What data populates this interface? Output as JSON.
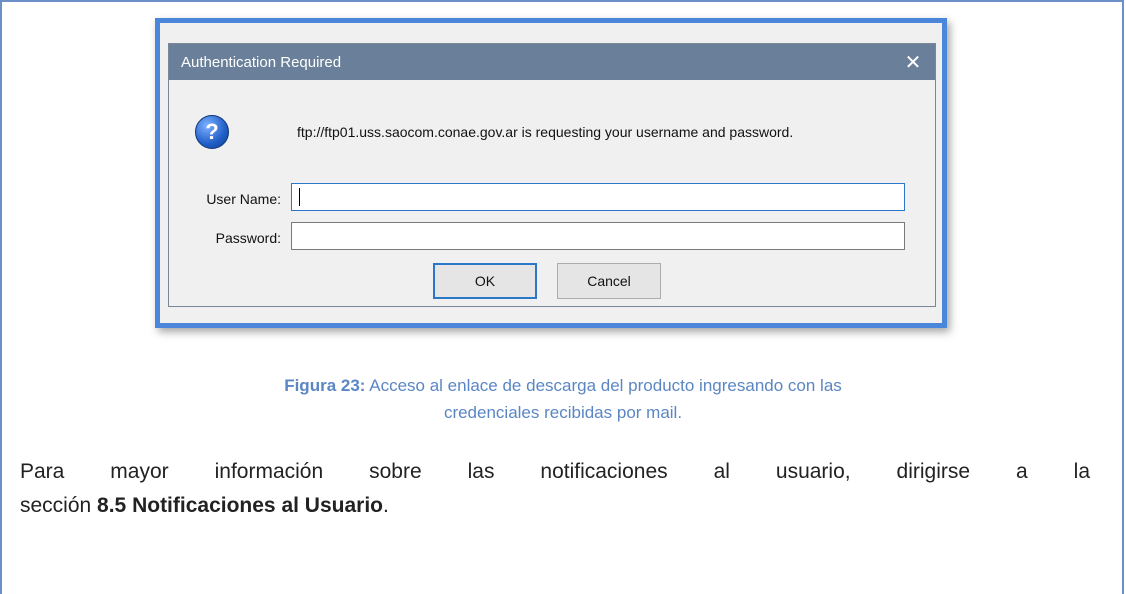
{
  "dialog": {
    "title": "Authentication Required",
    "message": "ftp://ftp01.uss.saocom.conae.gov.ar is requesting your username and password.",
    "username_label": "User Name:",
    "username_value": "",
    "password_label": "Password:",
    "password_value": "",
    "ok_label": "OK",
    "cancel_label": "Cancel",
    "question_icon_glyph": "?"
  },
  "caption": {
    "figure_label": "Figura 23:",
    "line1": " Acceso al enlace de descarga del producto ingresando con las",
    "line2": "credenciales recibidas por mail."
  },
  "paragraph": {
    "line1": "Para mayor información sobre las notificaciones al usuario, dirigirse a la",
    "line2_prefix": "sección ",
    "line2_bold": "8.5 Notificaciones al Usuario",
    "line2_suffix": "."
  },
  "colors": {
    "frame_border": "#4a86d9",
    "titlebar": "#6a7f99",
    "caption_text": "#5b86c4"
  }
}
